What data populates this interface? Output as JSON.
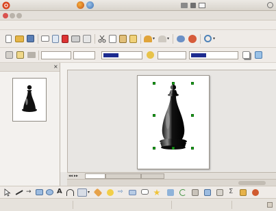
{
  "top_panel": {
    "menus": [
      {
        "label": ""
      },
      {
        "label": ""
      },
      {
        "label": ""
      }
    ],
    "clock": ""
  },
  "window": {
    "title": ""
  },
  "menubar": {
    "items": [
      {
        "label": ""
      },
      {
        "label": ""
      },
      {
        "label": ""
      },
      {
        "label": ""
      },
      {
        "label": ""
      },
      {
        "label": ""
      },
      {
        "label": ""
      },
      {
        "label": ""
      },
      {
        "label": ""
      }
    ]
  },
  "line_toolbar": {
    "line_style": "",
    "line_width": "",
    "line_color": "",
    "area_style": "",
    "area_color": ""
  },
  "pages_panel": {
    "title": "",
    "page_number": "",
    "page_label": ""
  },
  "ruler": {
    "horizontal_labels": "",
    "vertical_labels": ""
  },
  "layout_tabs": [
    {
      "label": ""
    },
    {
      "label": ""
    },
    {
      "label": ""
    }
  ],
  "statusbar": {
    "selection": "",
    "position": "",
    "size": "",
    "slide": "",
    "layout": ""
  },
  "colors": {
    "selection_handle": "#1aa81a",
    "canvas_bg": "#e8e6e3",
    "page_bg": "#ffffff"
  }
}
